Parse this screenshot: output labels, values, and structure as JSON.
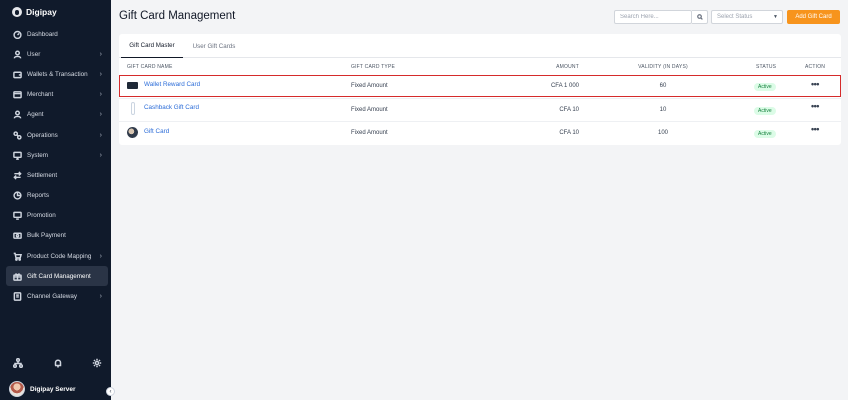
{
  "brand": {
    "name": "Digipay"
  },
  "sidebar": {
    "items": [
      {
        "label": "Dashboard",
        "icon": "dashboard-icon",
        "chevron": false,
        "active": false
      },
      {
        "label": "User",
        "icon": "user-icon",
        "chevron": true,
        "active": false
      },
      {
        "label": "Wallets & Transaction",
        "icon": "wallet-icon",
        "chevron": true,
        "active": false
      },
      {
        "label": "Merchant",
        "icon": "merchant-icon",
        "chevron": true,
        "active": false
      },
      {
        "label": "Agent",
        "icon": "agent-icon",
        "chevron": true,
        "active": false
      },
      {
        "label": "Operations",
        "icon": "operations-icon",
        "chevron": true,
        "active": false
      },
      {
        "label": "System",
        "icon": "system-icon",
        "chevron": true,
        "active": false
      },
      {
        "label": "Settlement",
        "icon": "settlement-icon",
        "chevron": false,
        "active": false
      },
      {
        "label": "Reports",
        "icon": "reports-icon",
        "chevron": false,
        "active": false
      },
      {
        "label": "Promotion",
        "icon": "promotion-icon",
        "chevron": false,
        "active": false
      },
      {
        "label": "Bulk Payment",
        "icon": "bulk-payment-icon",
        "chevron": false,
        "active": false
      },
      {
        "label": "Product Code Mapping",
        "icon": "cart-icon",
        "chevron": true,
        "active": false
      },
      {
        "label": "Gift Card Management",
        "icon": "gift-icon",
        "chevron": false,
        "active": true
      },
      {
        "label": "Channel Gateway",
        "icon": "gateway-icon",
        "chevron": true,
        "active": false
      }
    ],
    "bottom_icons": [
      "hierarchy-icon",
      "bell-icon",
      "gear-icon"
    ],
    "user_name": "Digipay Server"
  },
  "header": {
    "title": "Gift Card Management",
    "search_placeholder": "Search Here...",
    "status_placeholder": "Select Status",
    "add_button": "Add Gift Card"
  },
  "tabs": [
    {
      "label": "Gift Card Master",
      "active": true
    },
    {
      "label": "User Gift Cards",
      "active": false
    }
  ],
  "table": {
    "columns": [
      "GIFT CARD NAME",
      "GIFT CARD TYPE",
      "AMOUNT",
      "VALIDITY (IN DAYS)",
      "STATUS",
      "ACTION"
    ],
    "rows": [
      {
        "name": "Wallet Reward Card",
        "type": "Fixed Amount",
        "amount": "CFA 1 000",
        "validity": "60",
        "status": "Active",
        "highlighted": true
      },
      {
        "name": "Cashback Gift Card",
        "type": "Fixed Amount",
        "amount": "CFA 10",
        "validity": "10",
        "status": "Active",
        "highlighted": false
      },
      {
        "name": "Gift Card",
        "type": "Fixed Amount",
        "amount": "CFA 10",
        "validity": "100",
        "status": "Active",
        "highlighted": false
      }
    ],
    "action_glyph": "•••"
  },
  "colors": {
    "sidebar_bg": "#101a2b",
    "accent_orange": "#f7941d",
    "link_blue": "#2b6cd8",
    "highlight_red": "#d52b2b",
    "badge_green": "#15803d"
  }
}
